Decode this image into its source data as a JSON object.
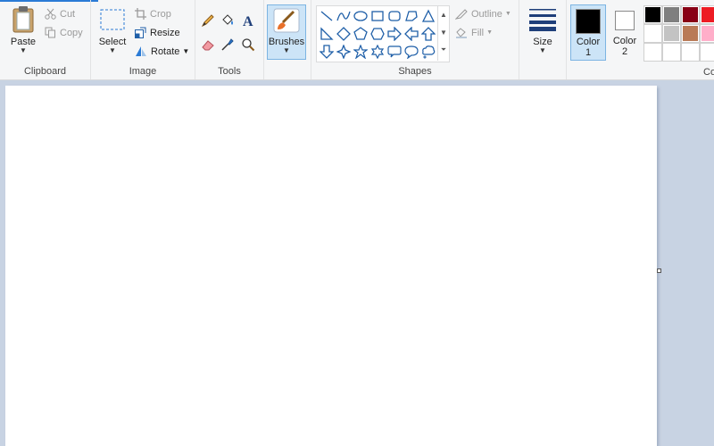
{
  "clipboard": {
    "paste_label": "Paste",
    "cut_label": "Cut",
    "copy_label": "Copy",
    "group_label": "Clipboard"
  },
  "image": {
    "select_label": "Select",
    "crop_label": "Crop",
    "resize_label": "Resize",
    "rotate_label": "Rotate",
    "group_label": "Image"
  },
  "tools": {
    "group_label": "Tools",
    "items": [
      "pencil-icon",
      "fill-bucket-icon",
      "text-icon",
      "eraser-icon",
      "color-picker-icon",
      "magnifier-icon"
    ]
  },
  "brushes": {
    "label": "Brushes"
  },
  "shapes": {
    "group_label": "Shapes",
    "outline_label": "Outline",
    "fill_label": "Fill"
  },
  "size": {
    "label": "Size"
  },
  "colors": {
    "color1_label": "Color",
    "color1_number": "1",
    "color2_label": "Color",
    "color2_number": "2",
    "color1_value": "#000000",
    "color2_value": "#ffffff",
    "group_label_partial": "Co",
    "palette_row1": [
      "#000000",
      "#7f7f7f",
      "#880015",
      "#ed1c24"
    ],
    "palette_row2": [
      "#ffffff",
      "#c3c3c3",
      "#b97a57",
      "#ffaec9"
    ]
  },
  "accent": "#2b7bd6"
}
